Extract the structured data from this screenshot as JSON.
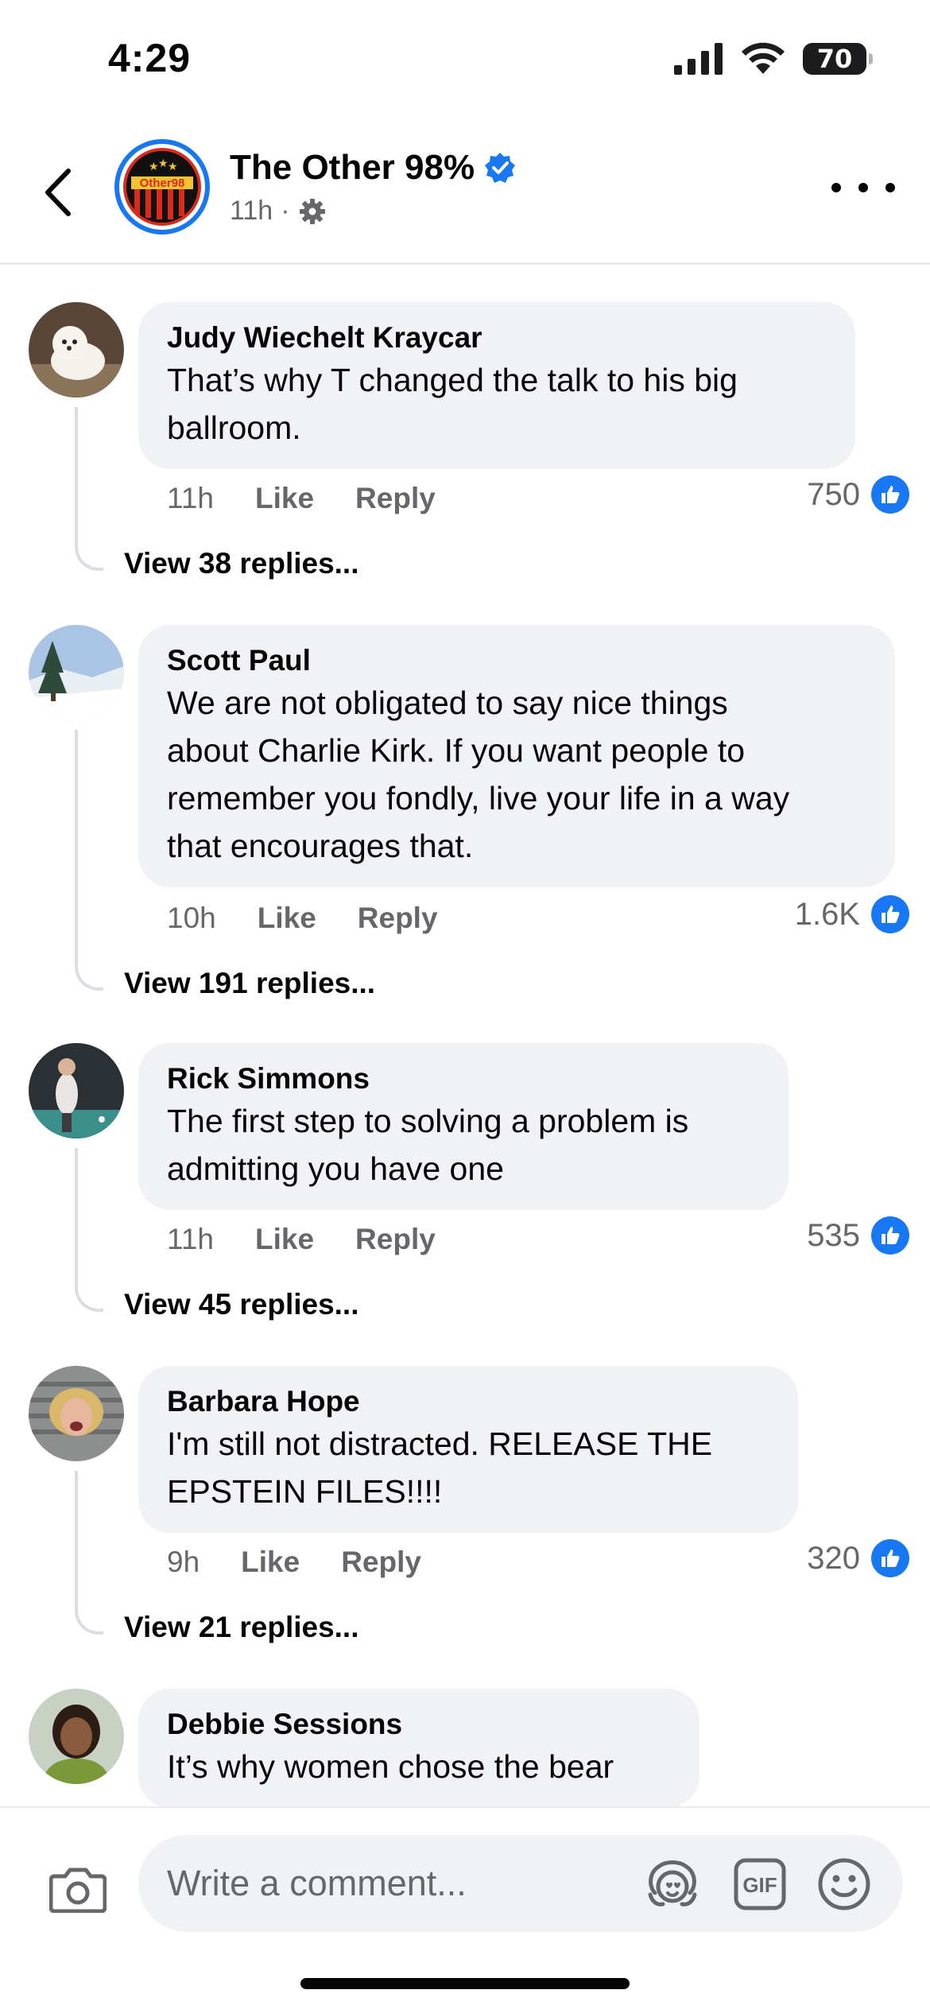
{
  "status_bar": {
    "time": "4:29",
    "battery": "70"
  },
  "header": {
    "page_name": "The Other 98%",
    "meta_time": "11h",
    "meta_separator": "·",
    "avatar_text": "Other98"
  },
  "comments": [
    {
      "author": "Judy Wiechelt Kraycar",
      "lines": [
        "That’s why T  changed the talk to his big",
        "ballroom."
      ],
      "time": "11h",
      "like_label": "Like",
      "reply_label": "Reply",
      "reaction_count": "750",
      "view_replies": "View 38 replies..."
    },
    {
      "author": "Scott Paul",
      "lines": [
        "We are not obligated to say nice things",
        "about Charlie Kirk. If you want people to",
        "remember you fondly, live your life in a way",
        "that encourages that."
      ],
      "time": "10h",
      "like_label": "Like",
      "reply_label": "Reply",
      "reaction_count": "1.6K",
      "view_replies": "View 191 replies..."
    },
    {
      "author": "Rick Simmons",
      "lines": [
        "The first step to solving a problem is",
        "admitting you have one"
      ],
      "time": "11h",
      "like_label": "Like",
      "reply_label": "Reply",
      "reaction_count": "535",
      "view_replies": "View 45 replies..."
    },
    {
      "author": "Barbara Hope",
      "lines": [
        "I'm still not distracted. RELEASE THE",
        "EPSTEIN FILES!!!!"
      ],
      "time": "9h",
      "like_label": "Like",
      "reply_label": "Reply",
      "reaction_count": "320",
      "view_replies": "View 21 replies..."
    },
    {
      "author": "Debbie Sessions",
      "lines": [
        "It’s why women chose the bear"
      ]
    }
  ],
  "composer": {
    "placeholder": "Write a comment...",
    "gif_label": "GIF"
  },
  "colors": {
    "accent": "#1877f2",
    "bubble": "#f0f2f5",
    "secondary_text": "#65676b"
  }
}
